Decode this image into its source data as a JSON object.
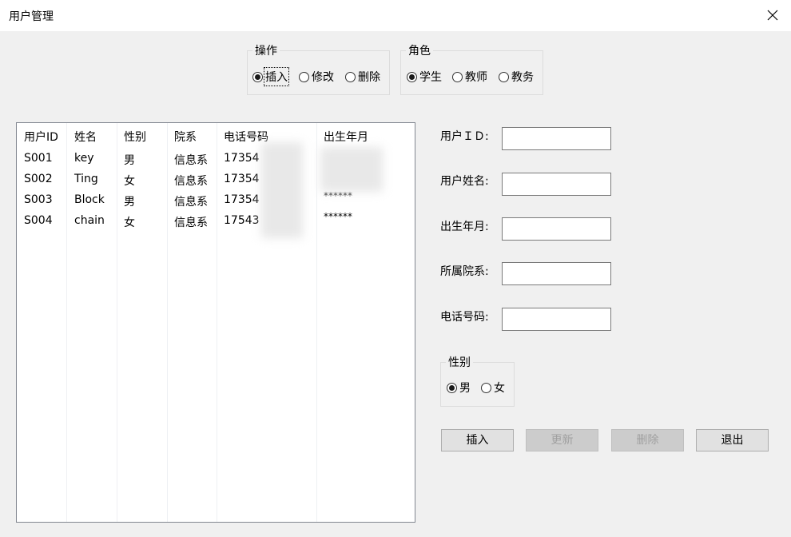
{
  "window": {
    "title": "用户管理"
  },
  "operation_group": {
    "legend": "操作",
    "options": [
      {
        "label": "插入",
        "checked": true
      },
      {
        "label": "修改",
        "checked": false
      },
      {
        "label": "删除",
        "checked": false
      }
    ]
  },
  "role_group": {
    "legend": "角色",
    "options": [
      {
        "label": "学生",
        "checked": true
      },
      {
        "label": "教师",
        "checked": false
      },
      {
        "label": "教务",
        "checked": false
      }
    ]
  },
  "table": {
    "columns": [
      "用户ID",
      "姓名",
      "性别",
      "院系",
      "电话号码",
      "出生年月"
    ],
    "rows": [
      [
        "S001",
        "key",
        "男",
        "信息系",
        "17354",
        ""
      ],
      [
        "S002",
        "Ting",
        "女",
        "信息系",
        "17354",
        ""
      ],
      [
        "S003",
        "Block",
        "男",
        "信息系",
        "17354",
        "******"
      ],
      [
        "S004",
        "chain",
        "女",
        "信息系",
        "17543",
        "******"
      ]
    ]
  },
  "form": {
    "user_id_label": "用户ＩＤ:",
    "user_name_label": "用户姓名:",
    "birth_label": "出生年月:",
    "dept_label": "所属院系:",
    "phone_label": "电话号码:",
    "user_id_value": "",
    "user_name_value": "",
    "birth_value": "",
    "dept_value": "",
    "phone_value": ""
  },
  "gender_group": {
    "legend": "性别",
    "options": [
      {
        "label": "男",
        "checked": true
      },
      {
        "label": "女",
        "checked": false
      }
    ]
  },
  "buttons": {
    "insert": "插入",
    "update": "更新",
    "delete": "删除",
    "exit": "退出"
  }
}
